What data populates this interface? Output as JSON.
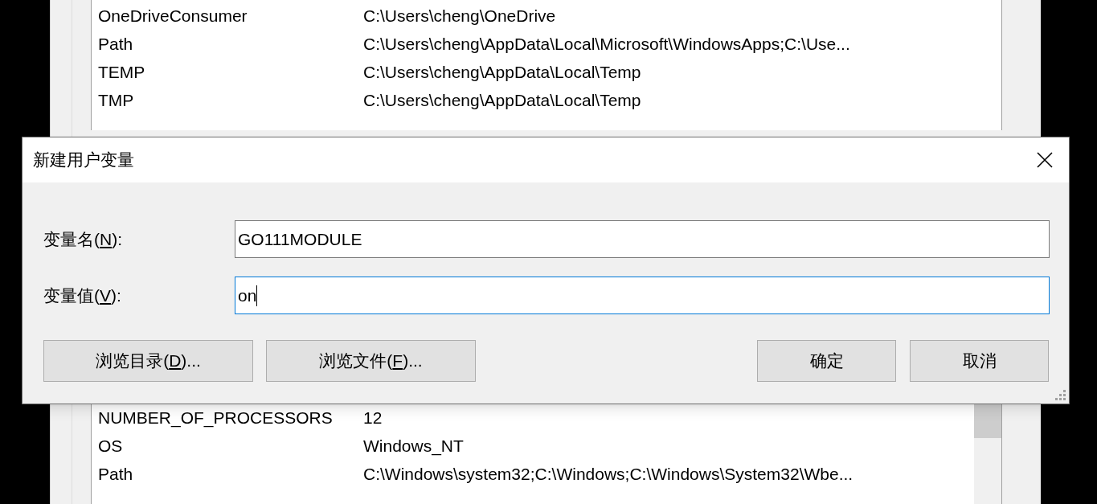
{
  "background_window": {
    "user_variables": [
      {
        "name": "OneDriveConsumer",
        "value": "C:\\Users\\cheng\\OneDrive"
      },
      {
        "name": "Path",
        "value": "C:\\Users\\cheng\\AppData\\Local\\Microsoft\\WindowsApps;C:\\Use..."
      },
      {
        "name": "TEMP",
        "value": "C:\\Users\\cheng\\AppData\\Local\\Temp"
      },
      {
        "name": "TMP",
        "value": "C:\\Users\\cheng\\AppData\\Local\\Temp"
      }
    ],
    "system_variables": [
      {
        "name": "NUMBER_OF_PROCESSORS",
        "value": "12"
      },
      {
        "name": "OS",
        "value": "Windows_NT"
      },
      {
        "name": "Path",
        "value": "C:\\Windows\\system32;C:\\Windows;C:\\Windows\\System32\\Wbe..."
      }
    ]
  },
  "dialog": {
    "title": "新建用户变量",
    "fields": [
      {
        "label_before": "变量名(",
        "access_key": "N",
        "label_after": "):",
        "value": "GO111MODULE",
        "focused": false
      },
      {
        "label_before": "变量值(",
        "access_key": "V",
        "label_after": "):",
        "value": "on",
        "focused": true
      }
    ],
    "left_buttons": [
      {
        "text_before": "浏览目录(",
        "access_key": "D",
        "text_after": ")..."
      },
      {
        "text_before": "浏览文件(",
        "access_key": "F",
        "text_after": ")..."
      }
    ],
    "right_buttons": [
      {
        "text_before": "确定"
      },
      {
        "text_before": "取消"
      }
    ]
  }
}
